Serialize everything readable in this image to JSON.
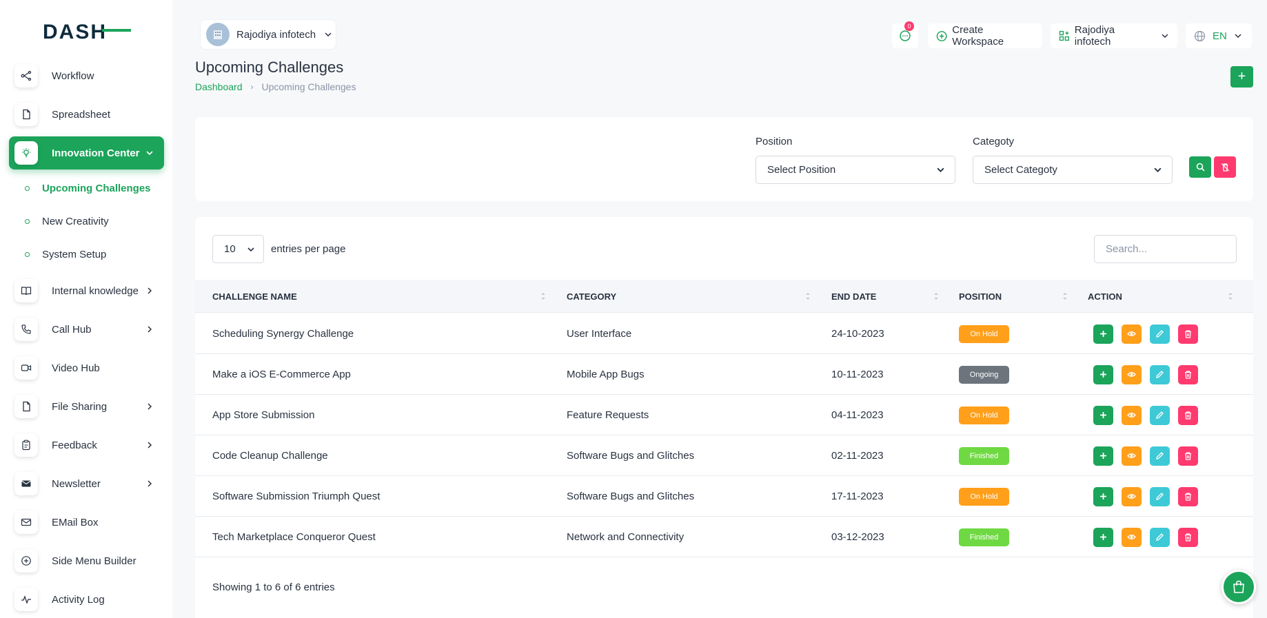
{
  "app": {
    "logo_text": "DASH"
  },
  "sidebar": {
    "items": [
      {
        "label": "Workflow",
        "icon": "workflow-icon"
      },
      {
        "label": "Spreadsheet",
        "icon": "file-icon"
      },
      {
        "label": "Innovation Center",
        "icon": "lightbulb-icon"
      },
      {
        "label": "Internal knowledge",
        "icon": "book-icon"
      },
      {
        "label": "Call Hub",
        "icon": "phone-icon"
      },
      {
        "label": "Video Hub",
        "icon": "video-icon"
      },
      {
        "label": "File Sharing",
        "icon": "file-icon"
      },
      {
        "label": "Feedback",
        "icon": "clipboard-icon"
      },
      {
        "label": "Newsletter",
        "icon": "mail-icon"
      },
      {
        "label": "EMail Box",
        "icon": "envelope-icon"
      },
      {
        "label": "Side Menu Builder",
        "icon": "plus-circle-icon"
      },
      {
        "label": "Activity Log",
        "icon": "pulse-icon"
      }
    ],
    "sub_items": [
      {
        "label": "Upcoming Challenges"
      },
      {
        "label": "New Creativity"
      },
      {
        "label": "System Setup"
      }
    ]
  },
  "header": {
    "workspace": "Rajodiya infotech",
    "notifications_count": "0",
    "create_workspace": "Create Workspace",
    "company": "Rajodiya infotech",
    "language": "EN"
  },
  "page": {
    "title": "Upcoming Challenges",
    "breadcrumb_home": "Dashboard",
    "breadcrumb_current": "Upcoming Challenges"
  },
  "filters": {
    "position_label": "Position",
    "position_value": "Select Position",
    "category_label": "Categoty",
    "category_value": "Select Categoty"
  },
  "table": {
    "page_size": "10",
    "entries_label": "entries per page",
    "search_placeholder": "Search...",
    "columns": [
      "Challenge Name",
      "Category",
      "End Date",
      "Position",
      "Action"
    ],
    "rows": [
      {
        "name": "Scheduling Synergy Challenge",
        "category": "User Interface",
        "end_date": "24-10-2023",
        "position": "On Hold"
      },
      {
        "name": "Make a iOS E-Commerce App",
        "category": "Mobile App Bugs",
        "end_date": "10-11-2023",
        "position": "Ongoing"
      },
      {
        "name": "App Store Submission",
        "category": "Feature Requests",
        "end_date": "04-11-2023",
        "position": "On Hold"
      },
      {
        "name": "Code Cleanup Challenge",
        "category": "Software Bugs and Glitches",
        "end_date": "02-11-2023",
        "position": "Finished"
      },
      {
        "name": "Software Submission Triumph Quest",
        "category": "Software Bugs and Glitches",
        "end_date": "17-11-2023",
        "position": "On Hold"
      },
      {
        "name": "Tech Marketplace Conqueror Quest",
        "category": "Network and Connectivity",
        "end_date": "03-12-2023",
        "position": "Finished"
      }
    ],
    "footer": "Showing 1 to 6 of 6 entries"
  },
  "colors": {
    "primary": "#1ba45a",
    "on_hold": "#ff9f1a",
    "ongoing": "#6c757d",
    "finished": "#6fd943",
    "info": "#3ec9d6",
    "danger": "#ff3a6e"
  }
}
